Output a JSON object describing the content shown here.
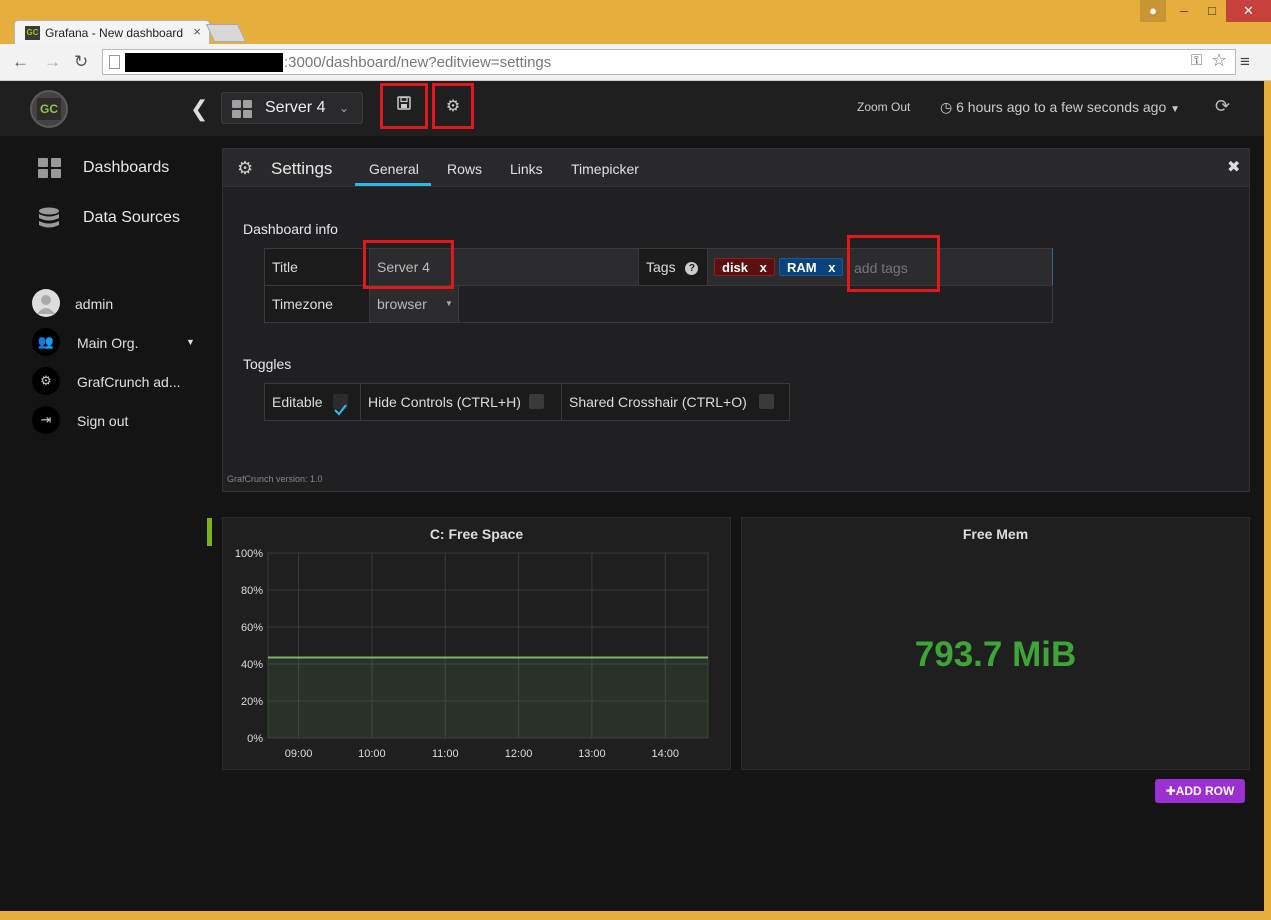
{
  "browser": {
    "tab_title": "Grafana - New dashboard",
    "tab_favicon": "GC",
    "url_text": ":3000/dashboard/new?editview=settings"
  },
  "topnav": {
    "logo_text": "GC",
    "dashboard_title": "Server 4",
    "zoom_out": "Zoom Out",
    "time_range": "6 hours ago to a few seconds ago"
  },
  "sidemenu": {
    "items": [
      {
        "label": "Dashboards",
        "icon": "dashboards-grid-icon"
      },
      {
        "label": "Data Sources",
        "icon": "database-icon"
      }
    ],
    "user": {
      "name": "admin"
    },
    "org": {
      "name": "Main Org."
    },
    "admin_link": "GrafCrunch ad...",
    "sign_out": "Sign out"
  },
  "settings": {
    "title": "Settings",
    "tabs": [
      "General",
      "Rows",
      "Links",
      "Timepicker"
    ],
    "active_tab": "General",
    "dashboard_info_heading": "Dashboard info",
    "title_label": "Title",
    "title_value": "Server 4",
    "tags_label": "Tags",
    "tags": [
      {
        "label": "disk",
        "remove": "x",
        "color": "#5b1010"
      },
      {
        "label": "RAM",
        "remove": "x",
        "color": "#0a437c"
      }
    ],
    "tags_placeholder": "add tags",
    "timezone_label": "Timezone",
    "timezone_value": "browser",
    "toggles_heading": "Toggles",
    "toggles": [
      {
        "label": "Editable",
        "checked": true
      },
      {
        "label": "Hide Controls (CTRL+H)",
        "checked": false
      },
      {
        "label": "Shared Crosshair (CTRL+O)",
        "checked": false
      }
    ],
    "version": "GrafCrunch version: 1.0"
  },
  "panels": {
    "free_space_title": "C: Free Space",
    "free_mem_title": "Free Mem",
    "free_mem_value": "793.7 MiB",
    "free_mem_color": "#3ea537"
  },
  "chart_data": {
    "type": "area",
    "title": "C: Free Space",
    "xlabel": "",
    "ylabel": "",
    "x_ticks": [
      "09:00",
      "10:00",
      "11:00",
      "12:00",
      "13:00",
      "14:00"
    ],
    "y_ticks": [
      "0%",
      "20%",
      "40%",
      "60%",
      "80%",
      "100%"
    ],
    "ylim": [
      0,
      100
    ],
    "x_range": [
      "08:35",
      "14:35"
    ],
    "series": [
      {
        "x": [
          "08:35",
          "14:35"
        ],
        "values": [
          43.5,
          43.5
        ],
        "color": "#7eb26d"
      }
    ],
    "grid": true,
    "legend": "none"
  },
  "add_row": "ADD ROW"
}
